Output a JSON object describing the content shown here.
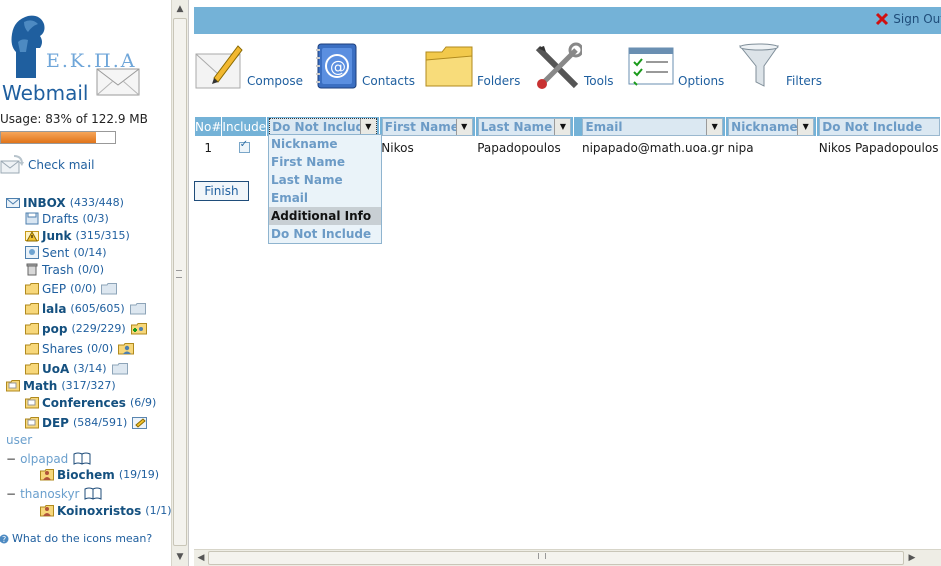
{
  "brand": {
    "logo_text": "Ε.Κ.Π.Α",
    "app_name": "Webmail"
  },
  "usage": {
    "text": "Usage: 83% of 122.9 MB",
    "percent": 83,
    "bar_color": "#e0741a"
  },
  "check_mail": {
    "label": "Check mail"
  },
  "folders": [
    {
      "label": "INBOX",
      "count": "(433/448)",
      "bold": true
    },
    {
      "label": "Drafts",
      "count": "(0/3)",
      "bold": false
    },
    {
      "label": "Junk",
      "count": "(315/315)",
      "bold": true
    },
    {
      "label": "Sent",
      "count": "(0/14)",
      "bold": false
    },
    {
      "label": "Trash",
      "count": "(0/0)",
      "bold": false
    },
    {
      "label": "GEP",
      "count": "(0/0)",
      "bold": false
    },
    {
      "label": "lala",
      "count": "(605/605)",
      "bold": true
    },
    {
      "label": "pop",
      "count": "(229/229)",
      "bold": true
    },
    {
      "label": "Shares",
      "count": "(0/0)",
      "bold": false
    },
    {
      "label": "UoA",
      "count": "(3/14)",
      "bold": true
    },
    {
      "label": "Math",
      "count": "(317/327)",
      "bold": true
    },
    {
      "label": "Conferences",
      "count": "(6/9)",
      "bold": true
    },
    {
      "label": "DEP",
      "count": "(584/591)",
      "bold": true
    },
    {
      "label": "Biochem",
      "count": "(19/19)",
      "bold": true
    },
    {
      "label": "Koinoxristos",
      "count": "(1/1)",
      "bold": true
    }
  ],
  "groups": {
    "user": "user",
    "olpapad": "olpapad",
    "thanoskyr": "thanoskyr",
    "tree_toggle": "−"
  },
  "help": {
    "label": "What do the icons mean?"
  },
  "topbar": {
    "sign_out": "Sign Out"
  },
  "toolbar": {
    "compose": "Compose",
    "contacts": "Contacts",
    "folders": "Folders",
    "tools": "Tools",
    "options": "Options",
    "filters": "Filters"
  },
  "table": {
    "col_no": "No#",
    "col_include": "Include",
    "col_selects": [
      "Do Not Include",
      "First Name",
      "Last Name",
      "Email",
      "Nickname",
      "Do Not Include"
    ],
    "row": {
      "no": "1",
      "include": true,
      "cells": [
        "",
        "Nikos",
        "Papadopoulos",
        "nipapado@math.uoa.gr",
        "nipa",
        "Nikos Papadopoulos"
      ]
    }
  },
  "dropdown": {
    "options": [
      "Nickname",
      "First Name",
      "Last Name",
      "Email",
      "Additional Info",
      "Do Not Include"
    ],
    "highlighted": "Additional Info"
  },
  "finish_label": "Finish",
  "colors": {
    "accent": "#74b2d7",
    "link": "#1f5f9f",
    "header_select_text": "#6c9bc6"
  }
}
